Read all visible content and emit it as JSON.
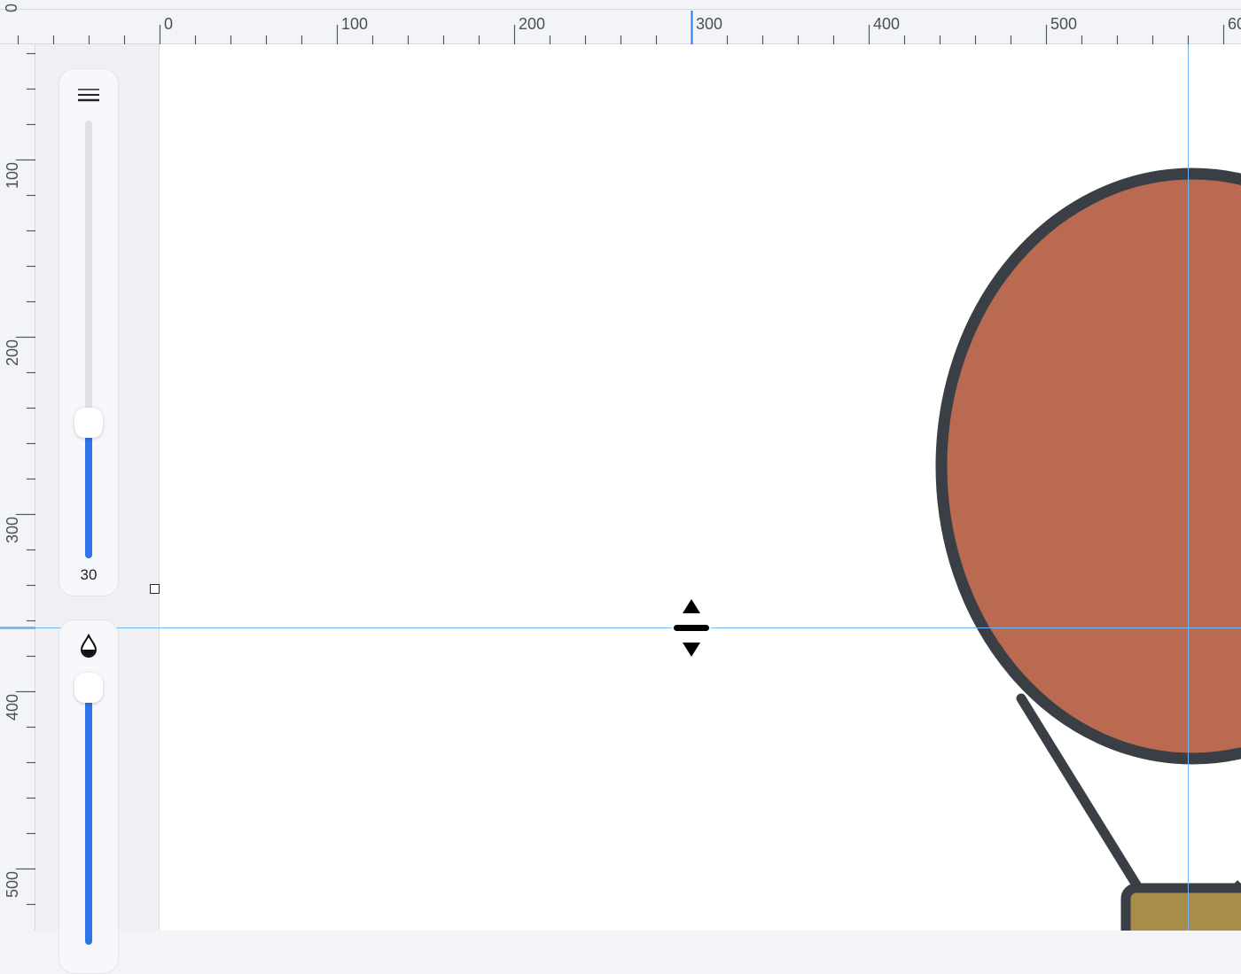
{
  "rulers": {
    "horizontal_labels": [
      "0",
      "100",
      "200",
      "300",
      "400",
      "500",
      "60"
    ],
    "vertical_labels": [
      "0",
      "100",
      "200",
      "300",
      "400",
      "500"
    ]
  },
  "stroke_panel": {
    "icon": "stroke-width-icon",
    "value": "30",
    "level": 0.3
  },
  "opacity_panel": {
    "icon": "opacity-drop-icon",
    "level": 1.0
  },
  "cursor": "resize-vertical-cursor",
  "colors": {
    "accent": "#2f74ea",
    "guide": "#6fb4f3",
    "balloon_envelope": "#b96a51",
    "balloon_basket": "#a88c4a",
    "outline": "#3a3f46",
    "canvas": "#ffffff",
    "ruler_bg": "#f3f4f7"
  }
}
